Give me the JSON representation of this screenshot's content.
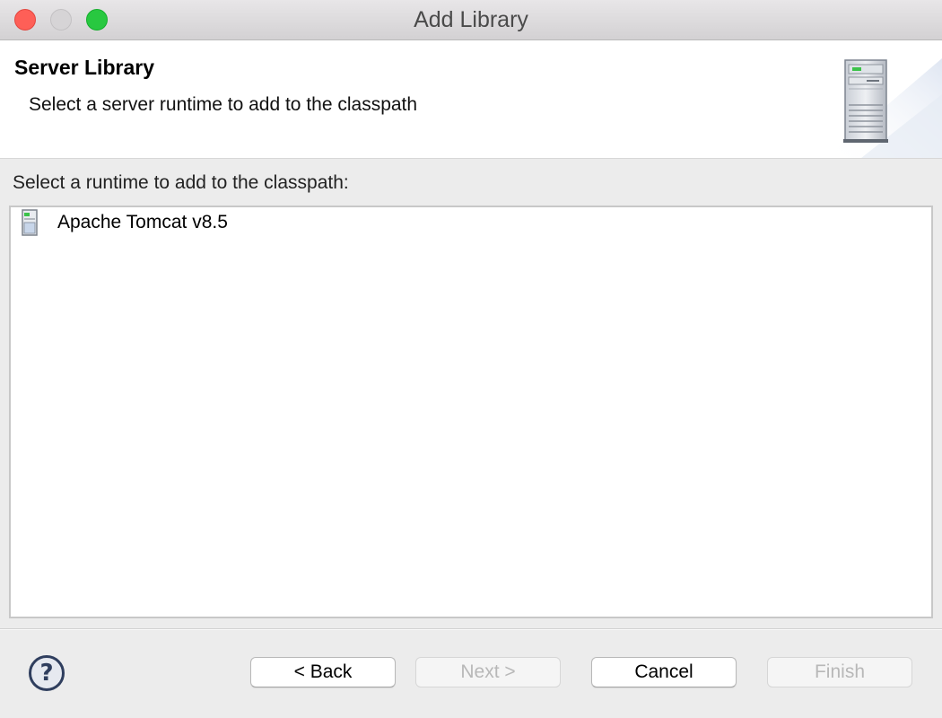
{
  "window": {
    "title": "Add Library"
  },
  "banner": {
    "title": "Server Library",
    "description": "Select a server runtime to add to the classpath",
    "graphic_icon": "server-tower-icon"
  },
  "main": {
    "prompt": "Select a runtime to add to the classpath:",
    "runtimes": [
      {
        "label": "Apache Tomcat v8.5",
        "icon": "server-icon"
      }
    ]
  },
  "footer": {
    "help_icon": "help-icon",
    "help_glyph": "?",
    "buttons": {
      "back": "< Back",
      "next": "Next >",
      "cancel": "Cancel",
      "finish": "Finish"
    }
  },
  "colors": {
    "close": "#fe5f57",
    "zoom": "#28c840",
    "help": "#2f3e5e"
  }
}
